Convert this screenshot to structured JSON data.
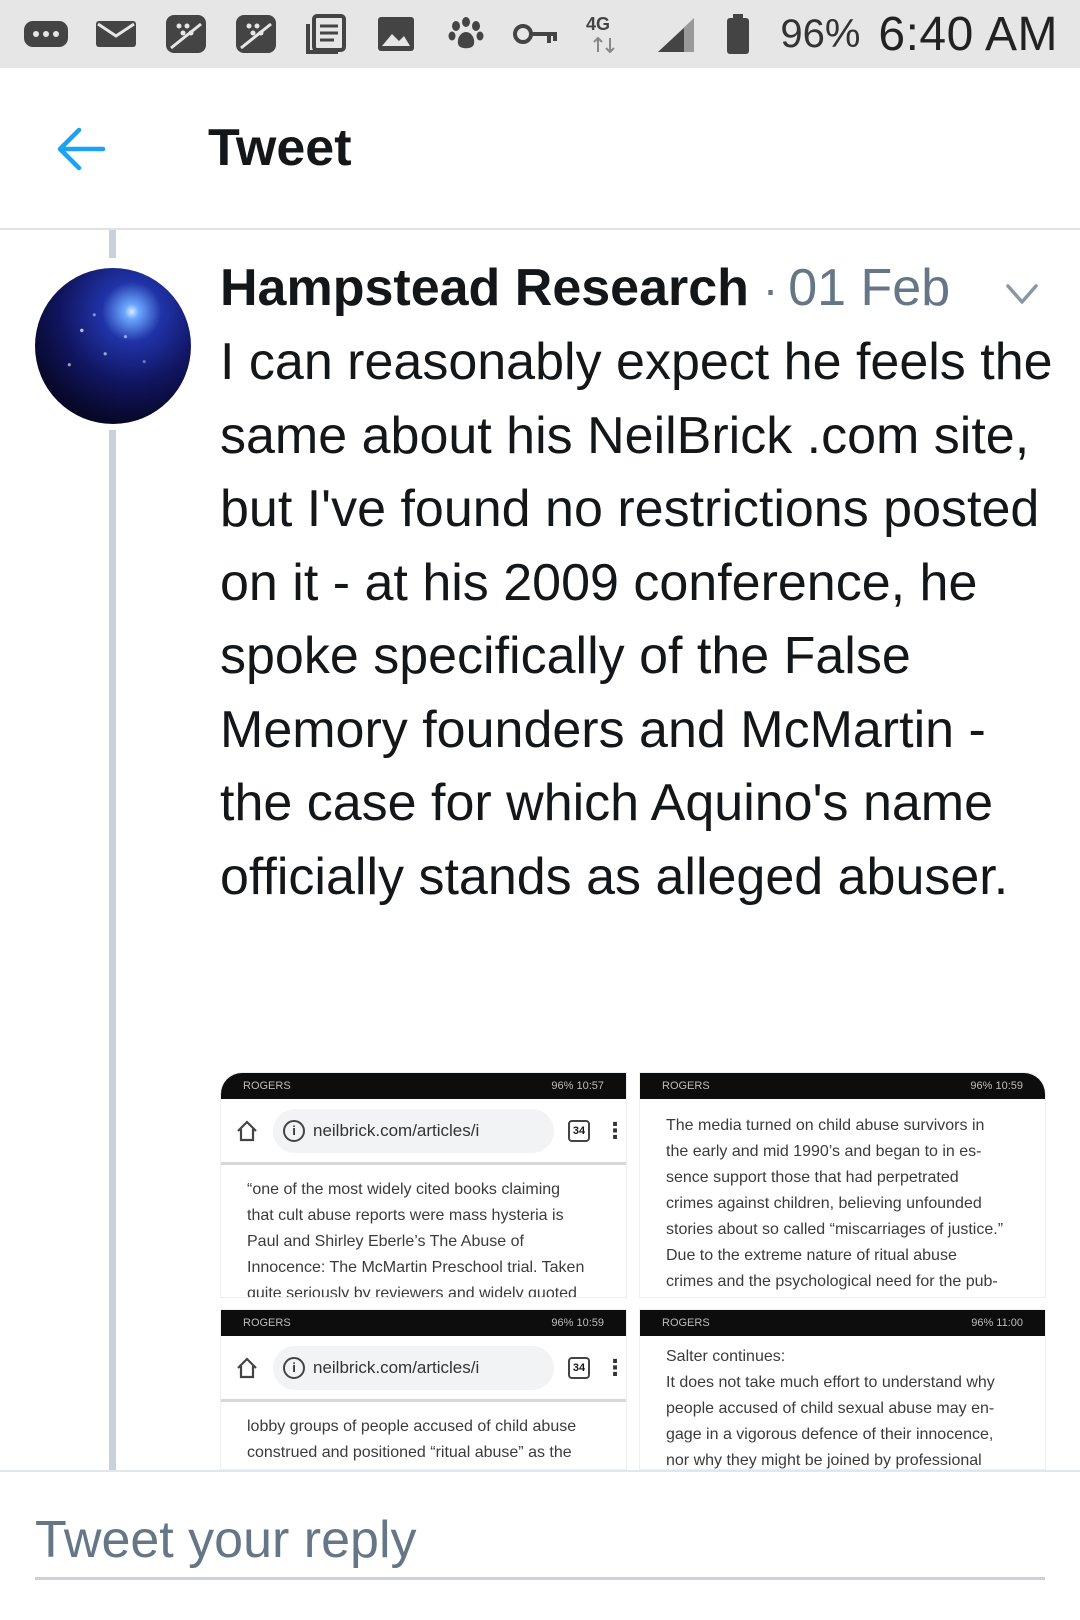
{
  "status_bar": {
    "icons": [
      "more-icon",
      "mail-icon",
      "blackberry-icon",
      "blackberry-icon",
      "news-icon",
      "gallery-icon",
      "paw-icon",
      "key-icon",
      "network-4g-icon",
      "signal-icon",
      "battery-icon"
    ],
    "network_label": "4G",
    "battery": "96%",
    "time": "6:40 AM"
  },
  "header": {
    "title": "Tweet"
  },
  "tweet": {
    "author": "Hampstead Research",
    "separator": "·",
    "date": "01 Feb",
    "text": "I can reasonably expect he feels the same about his NeilBrick .com site, but I've found no restrictions posted on it - at his 2009 conference, he spoke specifically of the False Memory founders and McMartin - the case for which Aquino's name officially stands as alleged abuser."
  },
  "media": [
    {
      "status_left": "ROGERS",
      "status_right": "96% 10:57",
      "url": "neilbrick.com/articles/i",
      "tab_count": "34",
      "text_lines": [
        "“one of the most widely cited books claiming",
        "that cult abuse reports were mass hysteria is",
        "Paul and Shirley Eberle’s The Abuse of",
        "Innocence: The McMartin Preschool trial. Taken",
        "quite seriously by reviewers and widely quoted"
      ]
    },
    {
      "status_left": "ROGERS",
      "status_right": "96% 10:59",
      "text_lines": [
        "The media turned on child abuse survivors in",
        "the early and mid 1990’s and began to in es-",
        "sence support those that had perpetrated",
        "crimes against children, believing unfounded",
        "stories about so called “miscarriages of justice.”",
        "Due to the extreme nature of ritual abuse",
        "crimes and the psychological need for the pub-"
      ]
    },
    {
      "status_left": "ROGERS",
      "status_right": "96% 10:59",
      "url": "neilbrick.com/articles/i",
      "tab_count": "34",
      "text_lines": [
        "lobby groups of people accused of child abuse",
        "construed and positioned “ritual abuse” as the"
      ]
    },
    {
      "status_left": "ROGERS",
      "status_right": "96% 11:00",
      "text_lines": [
        "Salter continues:",
        "It does not take much effort to understand why",
        "people accused of child sexual abuse may en-",
        "gage in a vigorous defence of their innocence,",
        "nor why they might be joined by professional"
      ]
    }
  ],
  "reply": {
    "placeholder": "Tweet your reply"
  },
  "colors": {
    "accent": "#1da1f2",
    "secondary_text": "#657786",
    "primary_text": "#14171a",
    "thread_line": "#c8d2dc"
  }
}
